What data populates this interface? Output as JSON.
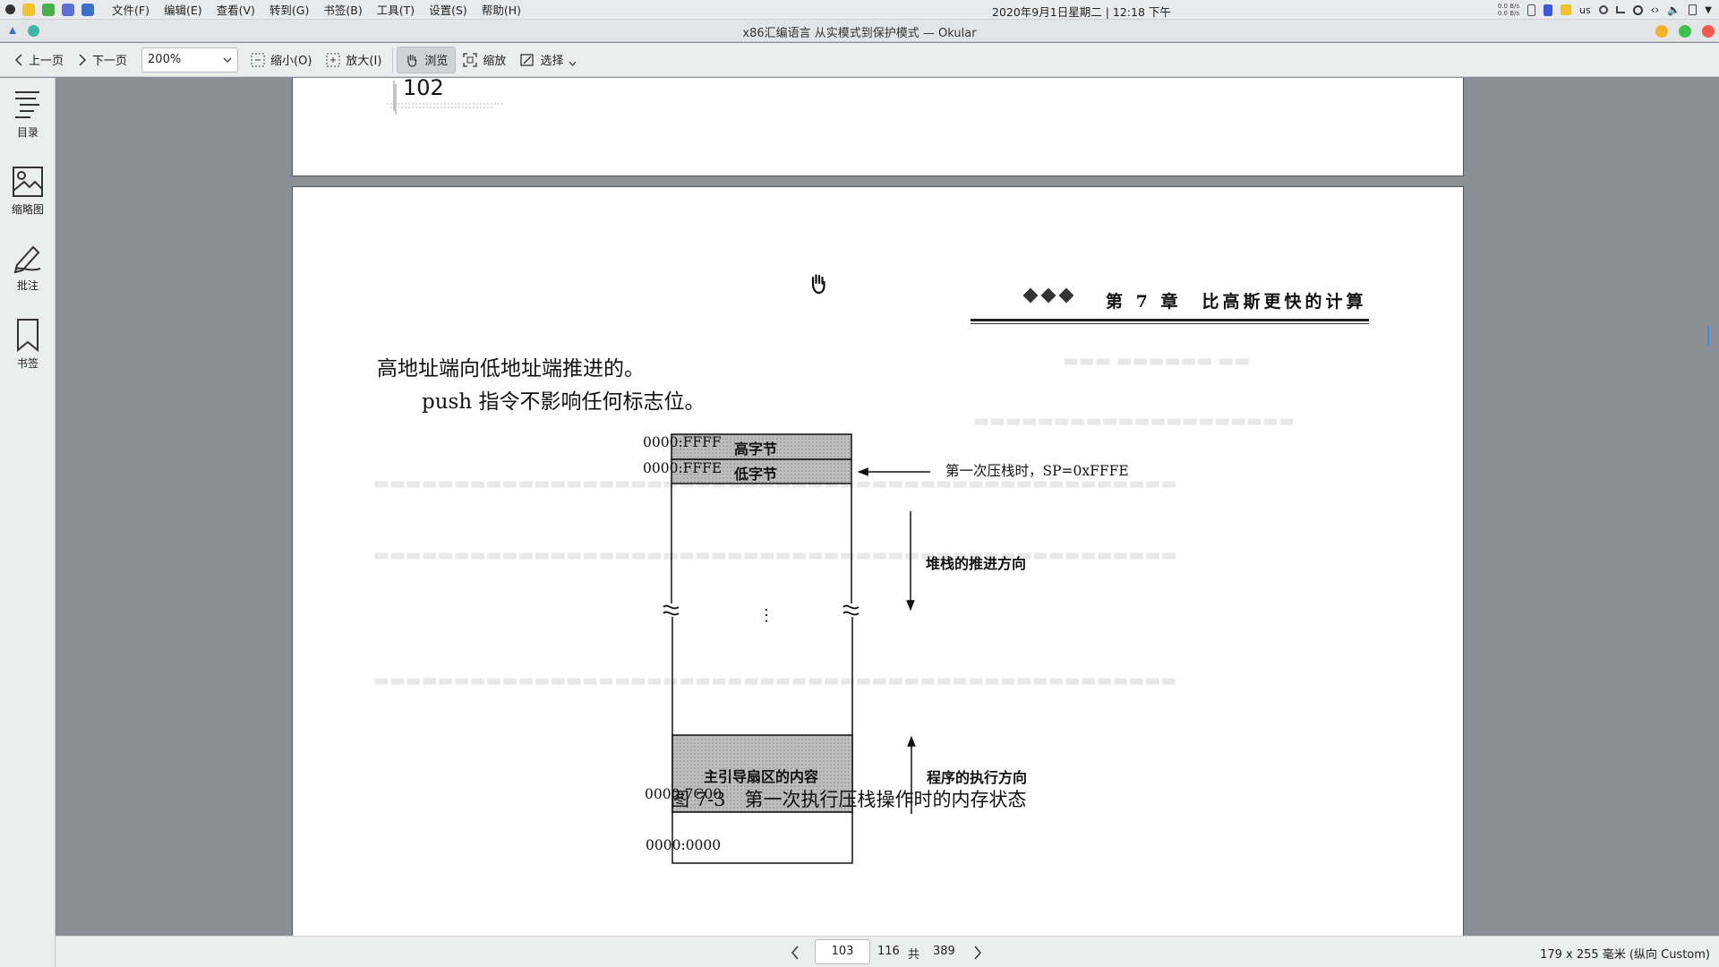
{
  "system_bar": {
    "menus": [
      "文件(F)",
      "编辑(E)",
      "查看(V)",
      "转到(G)",
      "书签(B)",
      "工具(T)",
      "设置(S)",
      "帮助(H)"
    ],
    "clock": "2020年9月1日星期二 | 12:18 下午",
    "net_up": "0.0 B/s",
    "net_down": "0.0 B/s",
    "keyboard_layout": "us"
  },
  "window": {
    "title": "x86汇编语言 从实模式到保护模式 — Okular",
    "colors": {
      "minimize": "#f5b12a",
      "maximize": "#3cc14a",
      "close": "#ee5a4f"
    }
  },
  "toolbar": {
    "prev_page": "上一页",
    "next_page": "下一页",
    "zoom_value": "200%",
    "zoom_out": "缩小(O)",
    "zoom_in": "放大(I)",
    "browse": "浏览",
    "zoom_tool": "缩放",
    "select": "选择"
  },
  "sidebar": {
    "items": [
      {
        "label": "目录",
        "icon": "toc-icon"
      },
      {
        "label": "缩略图",
        "icon": "thumbnails-icon"
      },
      {
        "label": "批注",
        "icon": "annotate-icon"
      },
      {
        "label": "书签",
        "icon": "bookmark-icon"
      }
    ]
  },
  "document": {
    "prev_page_number": "102",
    "chapter_header": "第 7 章　比高斯更快的计算",
    "paragraph_line1": "高地址端向低地址端推进的。",
    "paragraph_line2": "push 指令不影响任何标志位。",
    "figure": {
      "addr_ffff": "0000:FFFF",
      "addr_fffe": "0000:FFFE",
      "addr_7c00": "0000:7C00",
      "addr_0000": "0000:0000",
      "high_byte": "高字节",
      "low_byte": "低字节",
      "boot_sector": "主引导扇区的内容",
      "first_push": "第一次压栈时，SP=0xFFFE",
      "stack_direction": "堆栈的推进方向",
      "exec_direction": "程序的执行方向",
      "ellipsis": "⋮",
      "caption": "图 7-3　第一次执行压栈操作时的内存状态"
    }
  },
  "statusbar": {
    "current_page": "103",
    "page_label": "116",
    "of": "共",
    "total_pages": "389",
    "page_size": "179 x 255 毫米 (纵向 Custom)"
  }
}
